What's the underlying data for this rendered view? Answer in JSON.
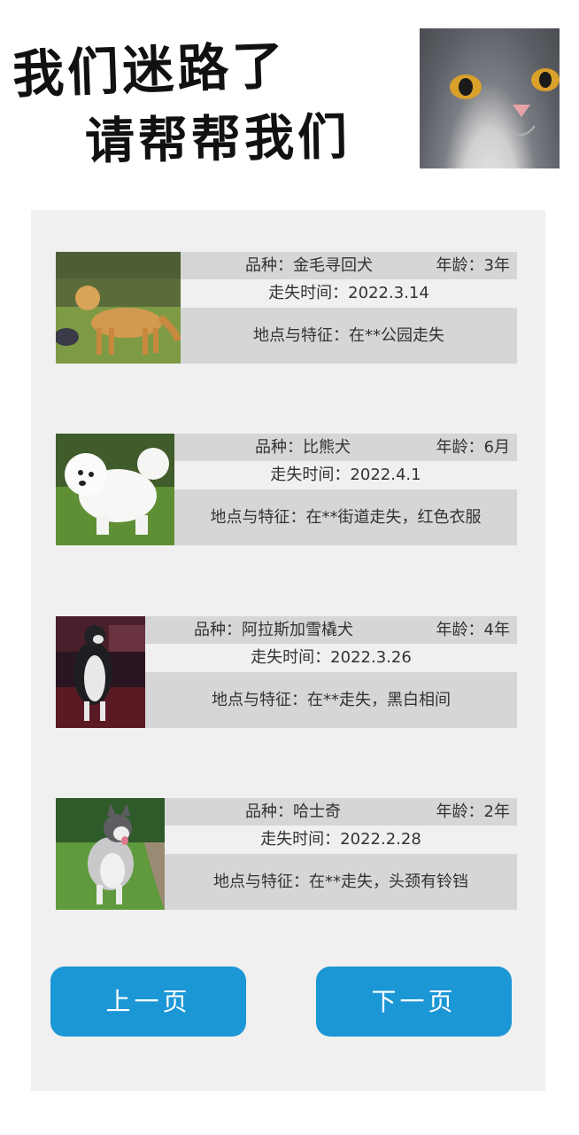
{
  "header": {
    "title_line1": "我们迷路了",
    "title_line2": "请帮帮我们"
  },
  "pets": [
    {
      "breed": "品种：金毛寻回犬",
      "age": "年龄：3年",
      "lost_time": "走失时间：2022.3.14",
      "location": "地点与特征：在**公园走失",
      "photo_icon": "golden-retriever-photo"
    },
    {
      "breed": "品种：比熊犬",
      "age": "年龄：6月",
      "lost_time": "走失时间：2022.4.1",
      "location": "地点与特征：在**街道走失，红色衣服",
      "photo_icon": "bichon-photo"
    },
    {
      "breed": "品种：阿拉斯加雪橇犬",
      "age": "年龄：4年",
      "lost_time": "走失时间：2022.3.26",
      "location": "地点与特征：在**走失，黑白相间",
      "photo_icon": "malamute-photo"
    },
    {
      "breed": "品种：哈士奇",
      "age": "年龄：2年",
      "lost_time": "走失时间：2022.2.28",
      "location": "地点与特征：在**走失，头颈有铃铛",
      "photo_icon": "husky-photo"
    }
  ],
  "pagination": {
    "prev_label": "上一页",
    "next_label": "下一页"
  },
  "colors": {
    "panel_bg": "#f0f0f0",
    "row_bg": "#d6d6d6",
    "button_bg": "#1c97d6",
    "button_text": "#ffffff"
  }
}
